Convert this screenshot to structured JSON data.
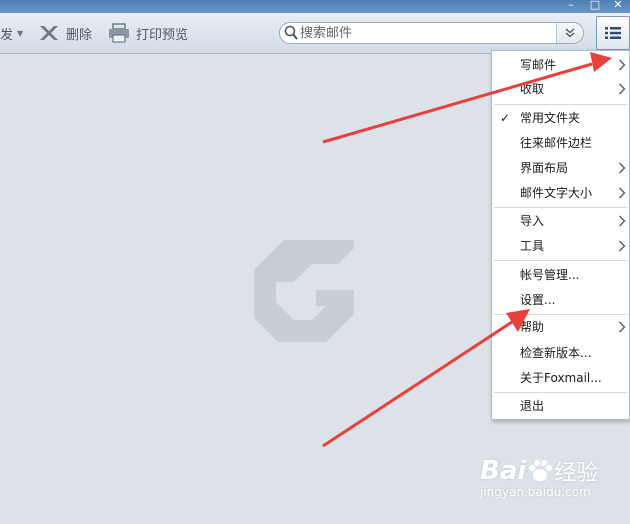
{
  "toolbar": {
    "partial_label": "发",
    "delete_label": "删除",
    "print_label": "打印预览"
  },
  "search": {
    "placeholder": "搜索邮件"
  },
  "menu": {
    "items": [
      {
        "label": "写邮件"
      },
      {
        "label": "收取"
      },
      {
        "label": "常用文件夹"
      },
      {
        "label": "往来邮件边栏"
      },
      {
        "label": "界面布局"
      },
      {
        "label": "邮件文字大小"
      },
      {
        "label": "导入"
      },
      {
        "label": "工具"
      },
      {
        "label": "帐号管理..."
      },
      {
        "label": "设置..."
      },
      {
        "label": "帮助"
      },
      {
        "label": "检查新版本..."
      },
      {
        "label": "关于Foxmail..."
      },
      {
        "label": "退出"
      }
    ]
  },
  "watermark": {
    "brand": "Bai",
    "brand_suffix": "经验",
    "domain": "jingyan.baidu.com"
  },
  "colors": {
    "arrow": "#e8403c",
    "accent": "#4f7fb3",
    "background": "#dde2e8"
  }
}
